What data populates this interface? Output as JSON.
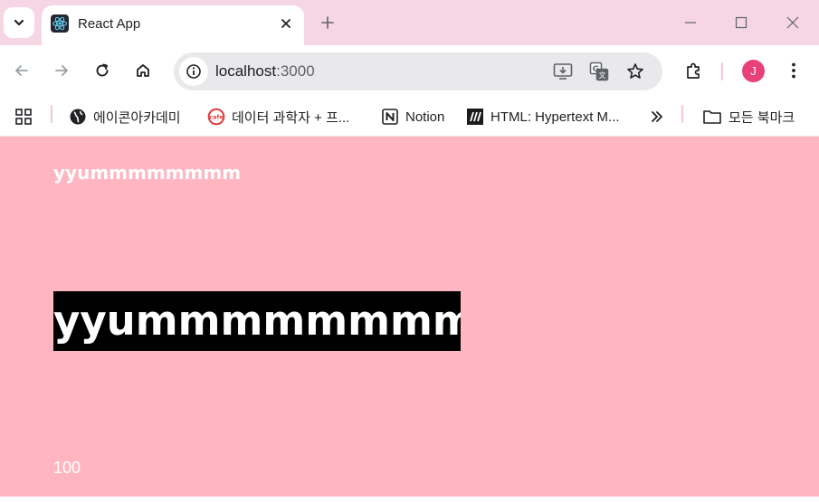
{
  "browser": {
    "tab": {
      "title": "React App",
      "favicon": "react-logo-icon"
    },
    "omnibox": {
      "host": "localhost",
      "port": ":3000"
    },
    "profile": {
      "initial": "J",
      "color": "#e8417a"
    },
    "bookmarks": [
      {
        "label": "에이콘아카데미",
        "icon": "globe-icon"
      },
      {
        "label": "데이터 과학자 + 프...",
        "icon": "cafe-icon"
      },
      {
        "label": "Notion",
        "icon": "notion-icon"
      },
      {
        "label": "HTML: Hypertext M...",
        "icon": "mdn-icon"
      }
    ],
    "all_bookmarks": "모든 북마크",
    "colors": {
      "tabstrip": "#f6d6e4",
      "omnibox": "#e9e9eb"
    }
  },
  "page": {
    "background": "#ffb6c1",
    "heading_small": "yyummmmmmmm",
    "heading_large": "yyummmmmmmm",
    "count": "100"
  }
}
